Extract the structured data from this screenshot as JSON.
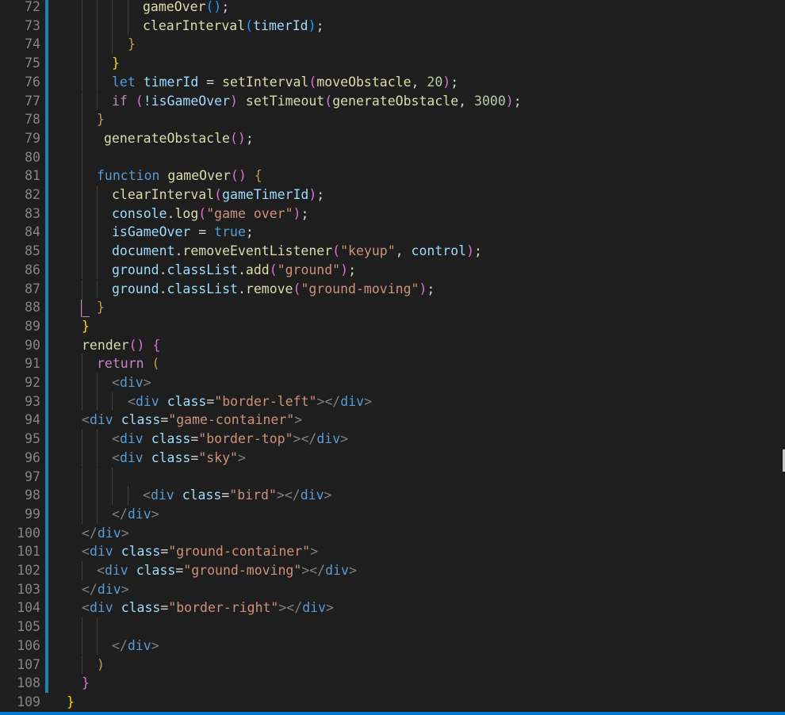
{
  "editor": {
    "line_numbers": [
      "72",
      "73",
      "74",
      "75",
      "76",
      "77",
      "78",
      "79",
      "80",
      "81",
      "82",
      "83",
      "84",
      "85",
      "86",
      "87",
      "88",
      "89",
      "90",
      "91",
      "92",
      "93",
      "94",
      "95",
      "96",
      "97",
      "98",
      "99",
      "100",
      "101",
      "102",
      "103",
      "104",
      "105",
      "106",
      "107",
      "108",
      "109"
    ],
    "tokens": {
      "l72_fn": "gameOver",
      "l73_fn": "clearInterval",
      "l73_var": "timerId",
      "l76_kw": "let",
      "l76_var": "timerId",
      "l76_fn": "setInterval",
      "l76_arg": "moveObstacle",
      "l76_num": "20",
      "l77_kw": "if",
      "l77_var": "!isGameOver",
      "l77_fn": "setTimeout",
      "l77_arg": "generateObstacle",
      "l77_num": "3000",
      "l79_fn": "generateObstacle",
      "l81_kw": "function",
      "l81_fn": "gameOver",
      "l82_fn": "clearInterval",
      "l82_var": "gameTimerId",
      "l83_obj": "console",
      "l83_fn": "log",
      "l83_str": "\"game over\"",
      "l84_var": "isGameOver",
      "l84_val": "true",
      "l85_obj": "document",
      "l85_fn": "removeEventListener",
      "l85_str": "\"keyup\"",
      "l85_arg": "control",
      "l86_obj": "ground",
      "l86_prop": "classList",
      "l86_fn": "add",
      "l86_str": "\"ground\"",
      "l87_obj": "ground",
      "l87_prop": "classList",
      "l87_fn": "remove",
      "l87_str": "\"ground-moving\"",
      "l90_fn": "render",
      "l91_kw": "return",
      "tag_div": "div",
      "attr_class": "class",
      "l93_str": "\"border-left\"",
      "l94_str": "\"game-container\"",
      "l95_str": "\"border-top\"",
      "l96_str": "\"sky\"",
      "l98_str": "\"bird\"",
      "l101_str": "\"ground-container\"",
      "l102_str": "\"ground-moving\"",
      "l104_str": "\"border-right\""
    }
  }
}
